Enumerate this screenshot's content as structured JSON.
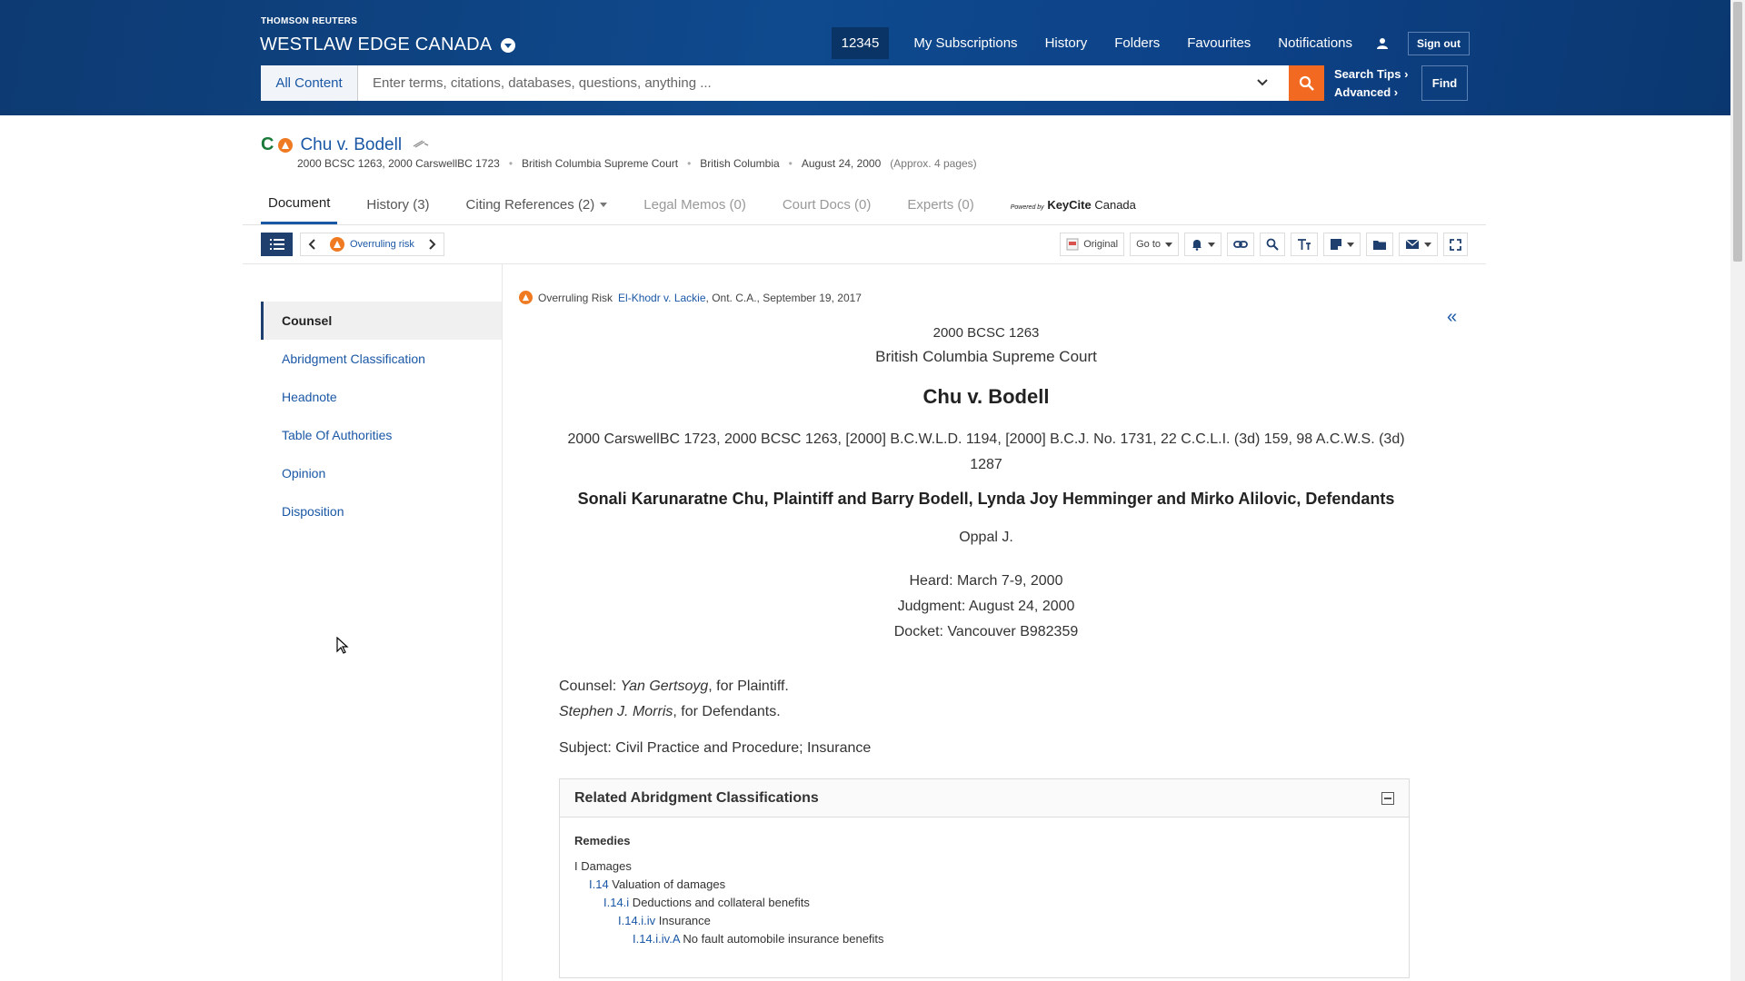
{
  "header": {
    "brand_small": "THOMSON REUTERS",
    "brand_big": "WESTLAW EDGE CANADA",
    "client_id": "12345",
    "nav": [
      "My Subscriptions",
      "History",
      "Folders",
      "Favourites",
      "Notifications"
    ],
    "sign_out": "Sign out",
    "content_select": "All Content",
    "search_placeholder": "Enter terms, citations, databases, questions, anything ...",
    "search_tips": "Search Tips ›",
    "advanced": "Advanced ›",
    "find": "Find",
    "accent_color": "#f26a21"
  },
  "document": {
    "keycite_flag": "C",
    "title": "Chu v. Bodell",
    "meta": {
      "citations": "2000 BCSC 1263, 2000 CarswellBC 1723",
      "court": "British Columbia Supreme Court",
      "jurisdiction": "British Columbia",
      "date": "August 24, 2000",
      "pages": "(Approx. 4 pages)"
    },
    "tabs": [
      {
        "label": "Document"
      },
      {
        "label": "History (3)"
      },
      {
        "label": "Citing References (2)"
      },
      {
        "label": "Legal Memos (0)"
      },
      {
        "label": "Court Docs (0)"
      },
      {
        "label": "Experts (0)"
      }
    ],
    "keycite_powered": "Powered by",
    "keycite_brand": "KeyCite",
    "keycite_country": " Canada"
  },
  "toolbar": {
    "overruling_risk": "Overruling risk",
    "original": "Original",
    "goto": "Go to"
  },
  "sidebar": {
    "items": [
      "Counsel",
      "Abridgment Classification",
      "Headnote",
      "Table Of Authorities",
      "Opinion",
      "Disposition"
    ]
  },
  "body": {
    "risk_prefix": "Overruling Risk",
    "risk_link": "El-Khodr v. Lackie",
    "risk_suffix": ", Ont. C.A., September 19, 2017",
    "cite_top": "2000 BCSC 1263",
    "court": "British Columbia Supreme Court",
    "case_name": "Chu v. Bodell",
    "citations": "2000 CarswellBC 1723, 2000 BCSC 1263, [2000] B.C.W.L.D. 1194, [2000] B.C.J. No. 1731, 22 C.C.L.I. (3d) 159, 98 A.C.W.S. (3d) 1287",
    "parties": "Sonali Karunaratne Chu, Plaintiff and Barry Bodell, Lynda Joy Hemminger and Mirko Alilovic, Defendants",
    "judge": "Oppal J.",
    "heard": "Heard: March 7-9, 2000",
    "judgment": "Judgment: August 24, 2000",
    "docket": "Docket: Vancouver B982359",
    "counsel_label": "Counsel: ",
    "counsel_plaintiff_name": "Yan Gertsoyg",
    "counsel_plaintiff_role": ", for Plaintiff.",
    "counsel_defendant_name": "Stephen J. Morris",
    "counsel_defendant_role": ", for Defendants.",
    "subject": "Subject: Civil Practice and Procedure; Insurance",
    "related": {
      "title": "Related Abridgment Classifications",
      "category": "Remedies",
      "levels": [
        {
          "code": "I",
          "text": " Damages"
        },
        {
          "code": "I.14",
          "text": " Valuation of damages"
        },
        {
          "code": "I.14.i",
          "text": " Deductions and collateral benefits"
        },
        {
          "code": "I.14.i.iv",
          "text": " Insurance"
        },
        {
          "code": "I.14.i.iv.A",
          "text": " No fault automobile insurance benefits"
        }
      ]
    }
  }
}
